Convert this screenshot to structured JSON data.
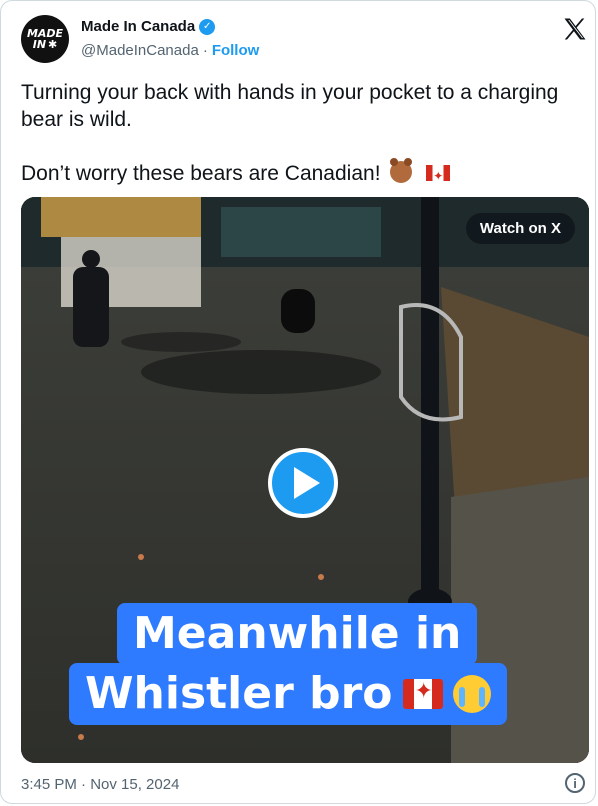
{
  "author": {
    "avatar_line1": "MADE",
    "avatar_line2": "IN",
    "name": "Made In Canada",
    "handle": "@MadeInCanada",
    "separator": "·",
    "follow_label": "Follow",
    "verified_icon": "verified-badge-icon"
  },
  "platform_icon": "x-logo-icon",
  "tweet": {
    "line1": "Turning your back with hands in your pocket to a charging bear is wild.",
    "line2": "Don’t worry these bears are Canadian!",
    "emojis": [
      "bear-face-emoji",
      "canada-flag-emoji"
    ]
  },
  "media": {
    "watch_label": "Watch on X",
    "play_icon": "play-icon",
    "caption_line1": "Meanwhile in",
    "caption_line2": "Whistler bro",
    "caption_emojis": [
      "canada-flag-emoji",
      "loudly-crying-face-emoji"
    ],
    "caption_bg": "#2f7bff"
  },
  "footer": {
    "timestamp": "3:45 PM · Nov 15, 2024",
    "info_icon": "info-icon"
  },
  "colors": {
    "accent": "#1d9bf0",
    "text": "#0f1419",
    "muted": "#536471"
  }
}
